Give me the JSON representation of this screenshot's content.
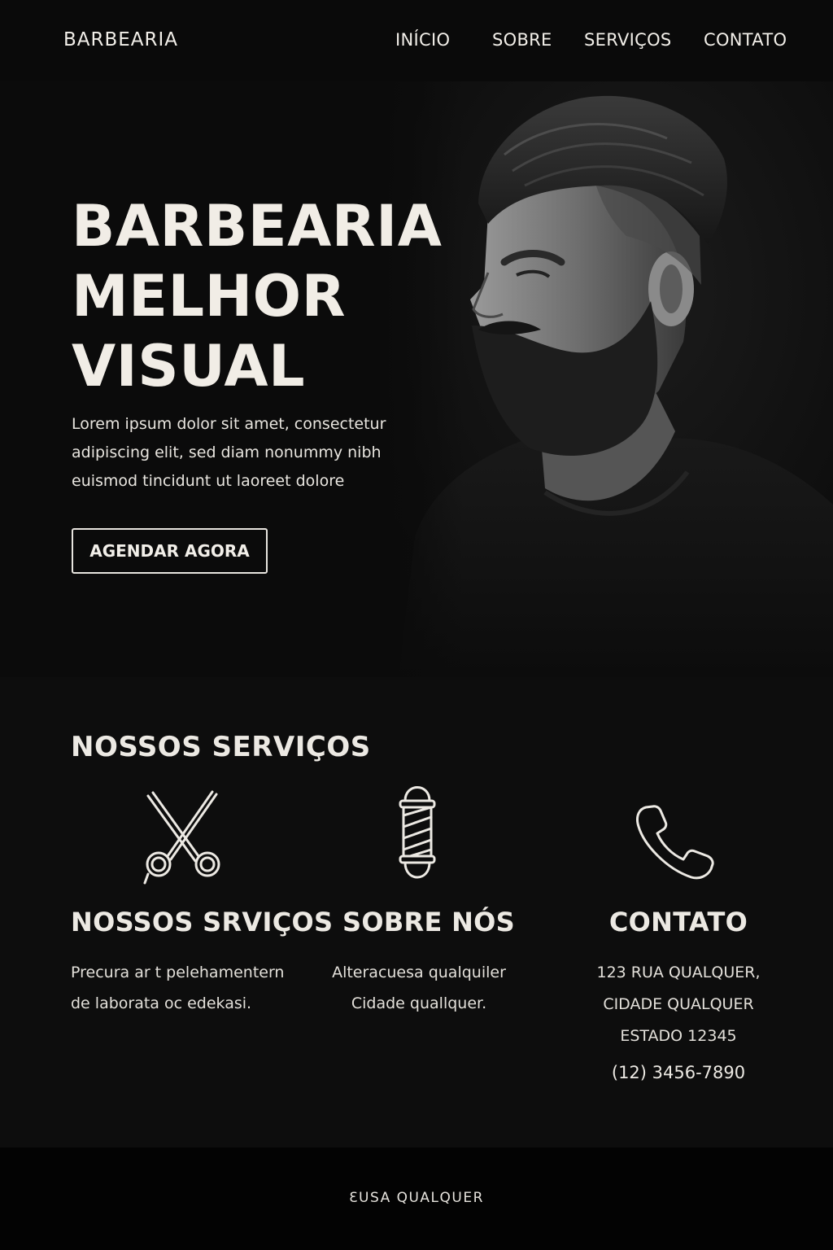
{
  "nav": {
    "brand": "BARBEARIA",
    "links": [
      "INÍCIO",
      "SOBRE",
      "SERVIÇOS",
      "CONTATO"
    ]
  },
  "hero": {
    "title_lines": [
      "BARBEARIA",
      "MELHOR",
      "VISUAL"
    ],
    "text_lines": [
      "Lorem ipsum dolor sit amet, consectetur",
      "adipiscing elit, sed diam nonummy nibh",
      "euismod tincidunt ut laoreet dolore"
    ],
    "cta_label": "AGENDAR AGORA"
  },
  "services": {
    "title": "NOSSOS SERVIÇOS",
    "columns": [
      {
        "icon": "scissors-icon",
        "heading": "NOSSOS SRVIÇOS",
        "lines": [
          "Precura ar t pelehamentern",
          "de laborata oc edekasi."
        ]
      },
      {
        "icon": "barber-pole-icon",
        "heading": "SOBRE NÓS",
        "lines": [
          "Alteracuesa qualquiler",
          "Cidade quallquer."
        ]
      },
      {
        "icon": "phone-icon",
        "heading": "CONTATO",
        "lines": [
          "123 RUA QUALQUER,",
          "CIDADE QUALQUER",
          "ESTADO 12345"
        ],
        "phone": "(12) 3456-7890"
      }
    ]
  },
  "footer": {
    "text": "ƐUSA QUALQUER"
  },
  "colors": {
    "background": "#0a0a0a",
    "text": "#ece9e3",
    "footer": "#030303"
  }
}
